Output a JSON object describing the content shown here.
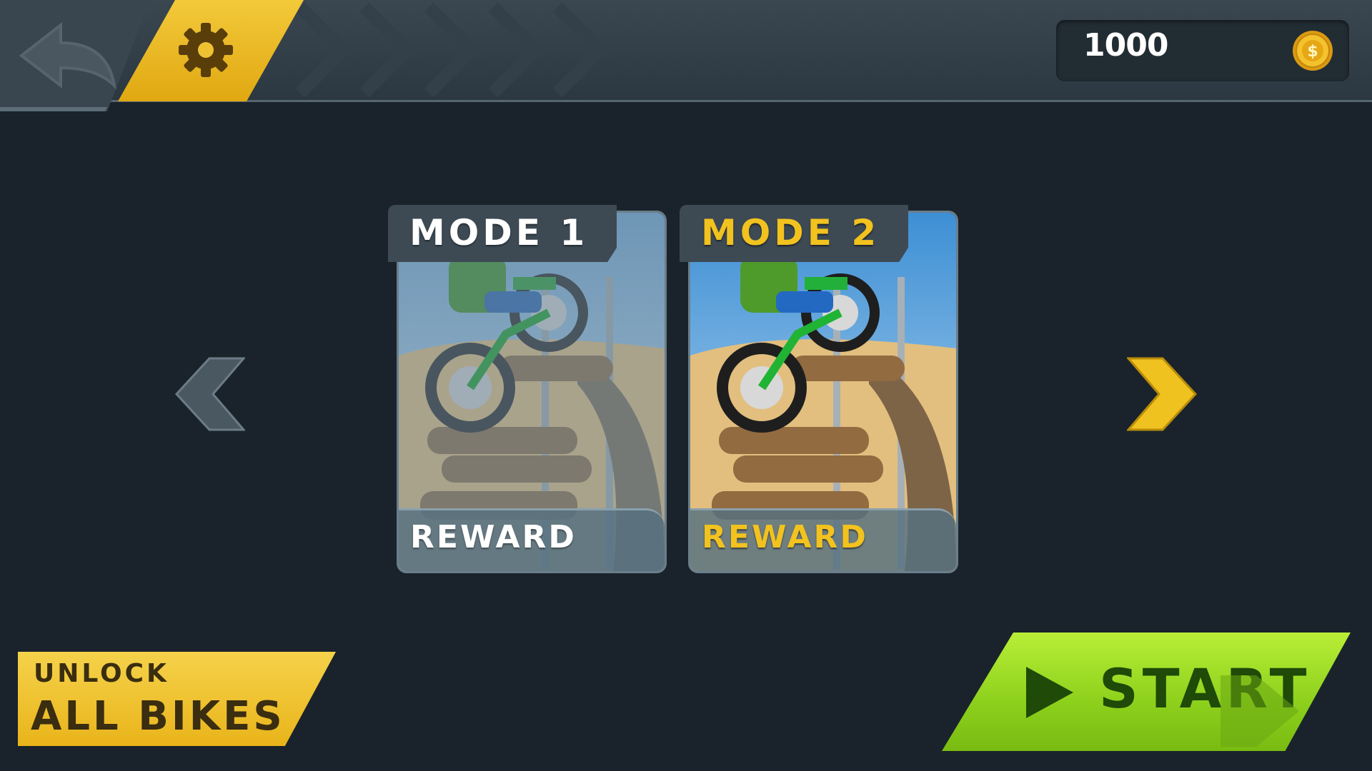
{
  "header": {
    "coins": "1000",
    "back_icon": "back-arrow-icon",
    "settings_icon": "gear-icon",
    "coin_icon": "dollar-coin-icon"
  },
  "modes": [
    {
      "title": "MODE 1",
      "footer": "REWARD",
      "selected": false
    },
    {
      "title": "MODE 2",
      "footer": "REWARD",
      "selected": true
    }
  ],
  "nav": {
    "prev_icon": "chevron-left-icon",
    "next_icon": "chevron-right-icon"
  },
  "unlock": {
    "line1": "UNLOCK",
    "line2": "ALL BIKES"
  },
  "start": {
    "label": "START",
    "icon": "play-icon"
  },
  "colors": {
    "accent_gold": "#f2c21f",
    "start_green": "#9ad726",
    "background": "#1a232b",
    "panel": "#3d4a54"
  }
}
